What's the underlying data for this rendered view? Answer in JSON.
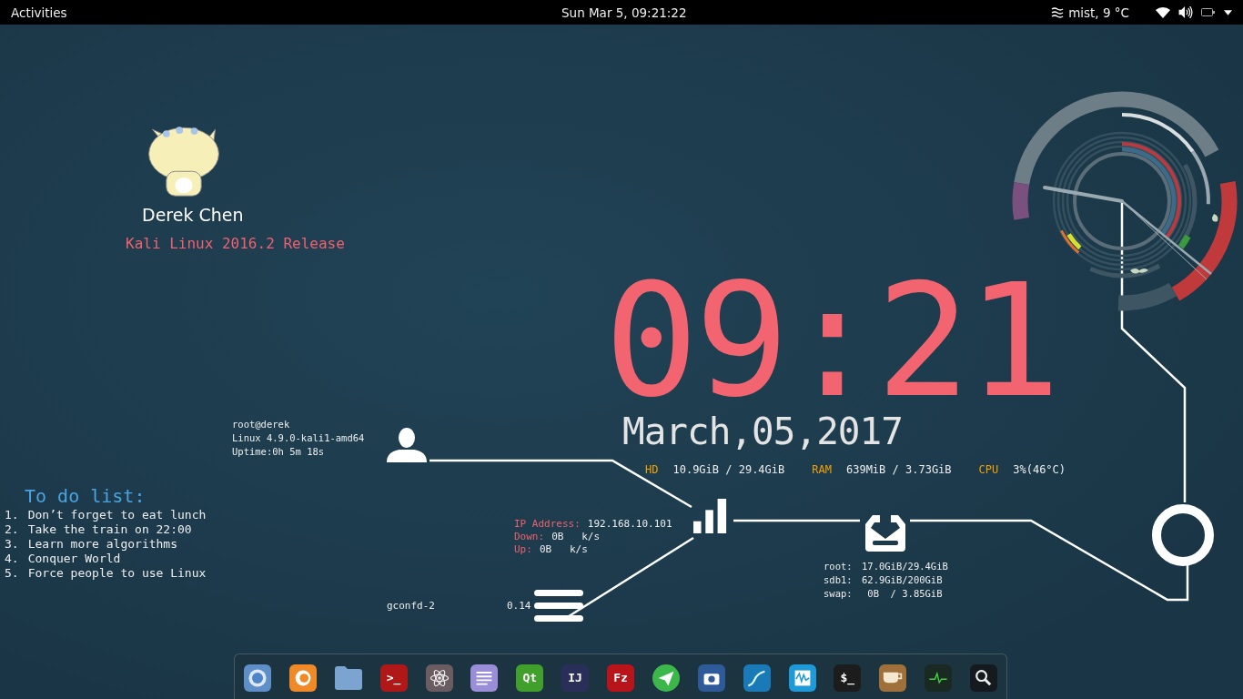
{
  "top_bar": {
    "activities": "Activities",
    "clock": "Sun Mar  5, 09:21:22",
    "weather": "mist, 9 °C"
  },
  "profile": {
    "name": "Derek Chen",
    "release": "Kali Linux 2016.2 Release"
  },
  "system": {
    "lines": [
      "root@derek",
      "Linux 4.9.0-kali1-amd64",
      "Uptime:0h 5m 18s"
    ]
  },
  "todo": {
    "title": "To do list:",
    "items": [
      {
        "number": "1.",
        "text": "Don’t forget to eat lunch"
      },
      {
        "number": "2.",
        "text": "Take the train on 22:00"
      },
      {
        "number": "3.",
        "text": "Learn more algorithms"
      },
      {
        "number": "4.",
        "text": "Conquer World"
      },
      {
        "number": "5.",
        "text": "Force people to use Linux"
      }
    ]
  },
  "clock": {
    "time": "09:21",
    "date": "March,05,2017"
  },
  "stats": [
    {
      "label": "HD",
      "value": "10.9GiB / 29.4GiB"
    },
    {
      "label": "RAM",
      "value": "639MiB / 3.73GiB"
    },
    {
      "label": "CPU",
      "value": "3%(46°C)"
    }
  ],
  "network": [
    {
      "label": "IP Address:",
      "value": "192.168.10.101"
    },
    {
      "label": "Down:",
      "value": "0B   k/s"
    },
    {
      "label": "Up:",
      "value": "0B   k/s"
    }
  ],
  "disks": [
    {
      "label": "root:",
      "value": "17.0GiB/29.4GiB"
    },
    {
      "label": "sdb1:",
      "value": "62.9GiB/200GiB"
    },
    {
      "label": "swap:",
      "value": " 0B  / 3.85GiB"
    }
  ],
  "process": {
    "name": "gconfd-2",
    "load": "0.14"
  },
  "dock": {
    "apps": [
      {
        "kind": "globe"
      },
      {
        "kind": "swirl"
      },
      {
        "kind": "folder"
      },
      {
        "kind": "prompt",
        "glyph": ">_"
      },
      {
        "kind": "atom"
      },
      {
        "kind": "document"
      },
      {
        "kind": "qt",
        "glyph": "Qt"
      },
      {
        "kind": "ide",
        "glyph": "IJ"
      },
      {
        "kind": "ftp",
        "glyph": "Fz"
      },
      {
        "kind": "send"
      },
      {
        "kind": "camera"
      },
      {
        "kind": "fin"
      },
      {
        "kind": "waveform"
      },
      {
        "kind": "shell",
        "glyph": "$_"
      },
      {
        "kind": "cup"
      },
      {
        "kind": "pulse"
      },
      {
        "kind": "search"
      }
    ]
  }
}
